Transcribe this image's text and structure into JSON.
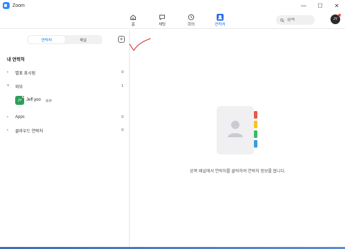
{
  "window": {
    "title": "Zoom",
    "controls": [
      "—",
      "☐",
      "✕"
    ]
  },
  "nav": {
    "tabs": [
      {
        "label": "홈",
        "icon": "home-icon",
        "active": false
      },
      {
        "label": "채팅",
        "icon": "chat-icon",
        "active": false
      },
      {
        "label": "회의",
        "icon": "clock-icon",
        "active": false
      },
      {
        "label": "연락처",
        "icon": "contacts-icon",
        "active": true
      }
    ],
    "search_placeholder": "검색",
    "avatar_initials": "JY"
  },
  "contacts_panel": {
    "segments": [
      {
        "label": "연락처",
        "active": true
      },
      {
        "label": "채널",
        "active": false
      }
    ],
    "add_symbol": "+",
    "section_title": "내 연락처",
    "groups": [
      {
        "chevron": "›",
        "label": "별표 표시됨",
        "count": "0"
      },
      {
        "chevron": "˅",
        "label": "외부",
        "count": "1"
      },
      {
        "chevron": "›",
        "label": "Apps",
        "count": "0"
      },
      {
        "chevron": "›",
        "label": "클라우드 연락처",
        "count": "0"
      }
    ],
    "contact": {
      "initials": "JY",
      "name": "Jeff yoo",
      "tag": "외부"
    }
  },
  "detail_panel": {
    "empty_message": "왼쪽 패널에서 연락처를 클릭하여 연락처 정보를 봅니다."
  },
  "colors": {
    "accent": "#2d6fe8",
    "tab_yellow": "#f5c518",
    "tab_red": "#e8574a",
    "tab_green": "#3bb86a",
    "tab_blue": "#3a9be0"
  }
}
